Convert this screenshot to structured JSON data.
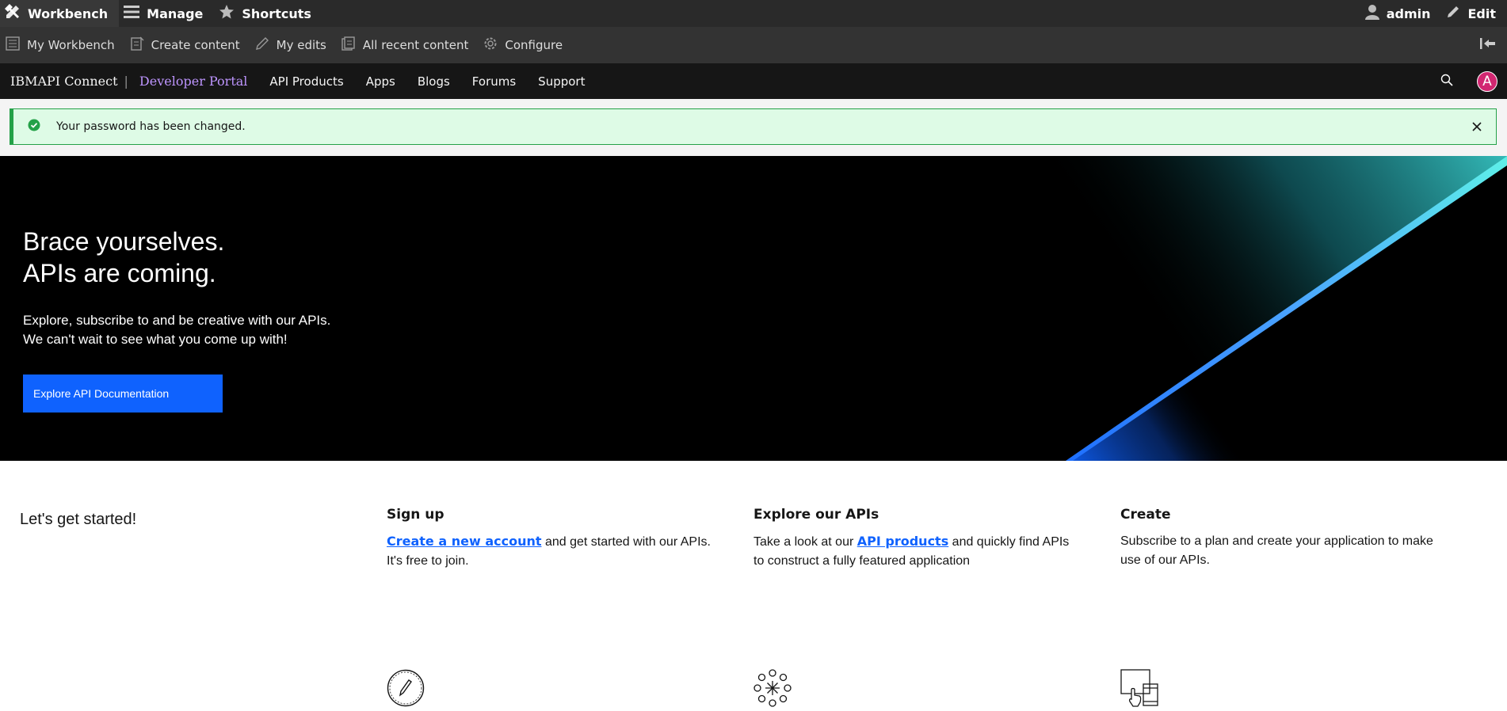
{
  "admin_toolbar": {
    "workbench": "Workbench",
    "manage": "Manage",
    "shortcuts": "Shortcuts",
    "user": "admin",
    "edit": "Edit"
  },
  "tray": {
    "items": [
      "My Workbench",
      "Create content",
      "My edits",
      "All recent content",
      "Configure"
    ]
  },
  "site_nav": {
    "brand": "IBMAPI Connect",
    "separator": "|",
    "sub_brand": "Developer Portal",
    "menu": [
      "API Products",
      "Apps",
      "Blogs",
      "Forums",
      "Support"
    ],
    "avatar_letter": "A"
  },
  "status_message": {
    "text": "Your password has been changed."
  },
  "hero": {
    "title_line1": "Brace yourselves.",
    "title_line2": "APIs are coming.",
    "lead_line1": "Explore, subscribe to and be creative with our APIs.",
    "lead_line2": "We can't wait to see what you come up with!",
    "cta": "Explore API Documentation"
  },
  "get_started": {
    "heading": "Let's get started!",
    "columns": [
      {
        "title": "Sign up",
        "link": "Create a new account",
        "text_after": " and get started with our APIs. It's free to join."
      },
      {
        "title": "Explore our APIs",
        "text_before": "Take a look at our ",
        "link": "API products",
        "text_after": " and quickly find APIs to construct a fully featured application"
      },
      {
        "title": "Create",
        "text": "Subscribe to a plan and create your application to make use of our APIs."
      }
    ]
  },
  "colors": {
    "accent": "#0f62fe",
    "success": "#24a148",
    "success_bg": "#defbe6",
    "sub_brand": "#be95ff",
    "avatar": "#d12771"
  },
  "icons": [
    "workbench-icon",
    "manage-icon",
    "star-icon",
    "user-icon",
    "pencil-icon",
    "list-icon",
    "create-content-icon",
    "edit-icon",
    "recent-content-icon",
    "gear-icon",
    "collapse-icon",
    "search-icon",
    "check-icon",
    "close-icon",
    "sign-up-icon",
    "explore-icon",
    "create-icon"
  ]
}
